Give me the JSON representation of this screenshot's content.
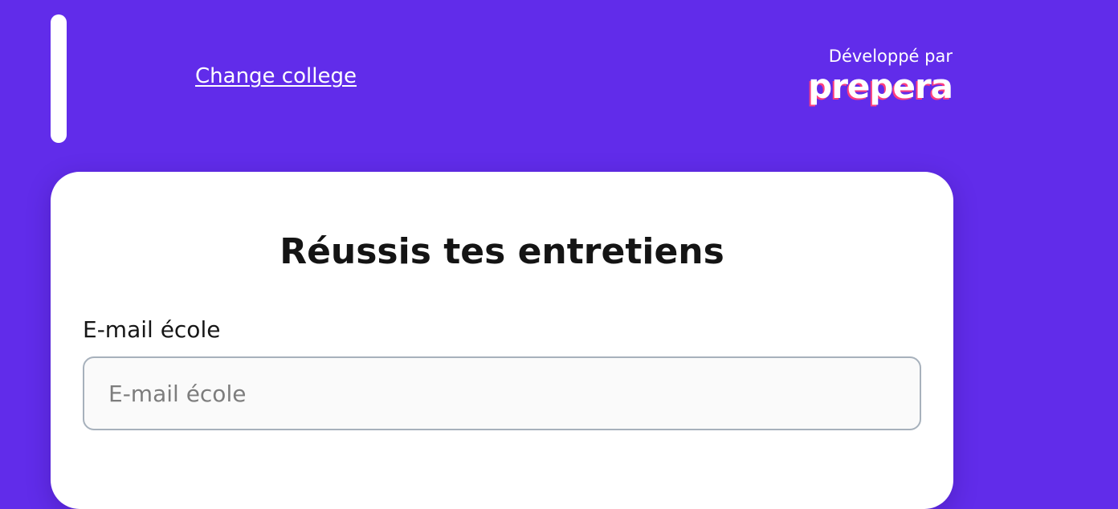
{
  "header": {
    "change_college_label": "Change college",
    "brand": {
      "developed_by": "Développé par",
      "logo_text": "prepera"
    }
  },
  "card": {
    "title": "Réussis tes entretiens",
    "email": {
      "label": "E-mail école",
      "placeholder": "E-mail école",
      "value": ""
    }
  },
  "colors": {
    "background": "#612cea",
    "card": "#ffffff",
    "logo_accent": "#ff3e7f",
    "input_border": "#a7b1bc"
  }
}
